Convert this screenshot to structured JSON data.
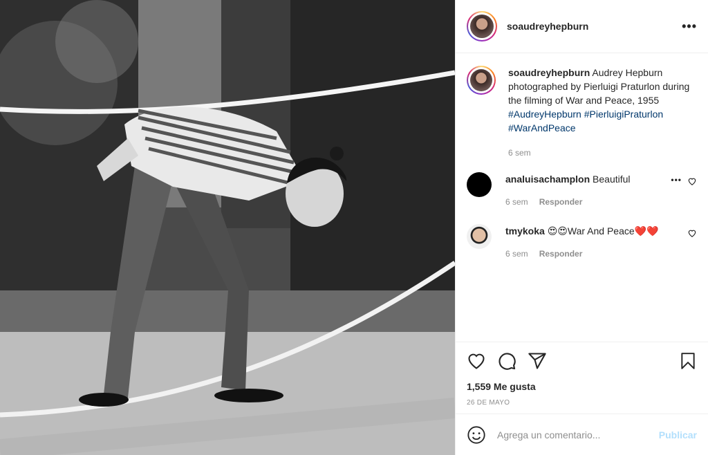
{
  "post": {
    "username": "soaudreyhepburn",
    "caption_text": "Audrey Hepburn photographed by Pierluigi Praturlon during the filming of War and Peace, 1955",
    "hashtags": [
      "#AudreyHepburn",
      "#PierluigiPraturlon",
      "#WarAndPeace"
    ],
    "caption_time": "6 sem",
    "likes": "1,559 Me gusta",
    "date": "26 DE MAYO"
  },
  "header": {
    "more_label": "•••"
  },
  "comments": [
    {
      "user": "analuisachamplon",
      "text": "Beautiful",
      "time": "6 sem",
      "reply": "Responder"
    },
    {
      "user": "tmykoka",
      "text": "😍😍War And Peace❤️❤️",
      "time": "6 sem",
      "reply": "Responder"
    }
  ],
  "comment_more": "•••",
  "add_comment": {
    "placeholder": "Agrega un comentario...",
    "publish": "Publicar"
  },
  "colors": {
    "link": "#00376b",
    "publish_disabled": "#b2dffc",
    "meta": "#8e8e8e"
  }
}
